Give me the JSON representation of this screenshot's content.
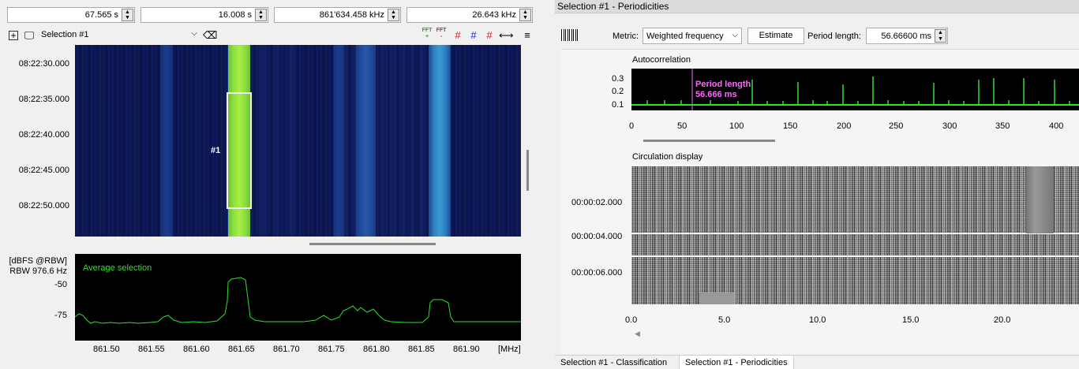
{
  "toolbar": {
    "start_time": "67.565 s",
    "duration": "16.008 s",
    "center_freq": "861'634.458 kHz",
    "bandwidth": "26.643 kHz",
    "selection_combo": "Selection #1"
  },
  "waterfall": {
    "time_labels": [
      "08:22:30.000",
      "08:22:35.000",
      "08:22:40.000",
      "08:22:45.000",
      "08:22:50.000"
    ],
    "selection_label": "#1"
  },
  "spectrum": {
    "y_unit": "[dBFS @RBW]",
    "rbw": "RBW 976.6 Hz",
    "trace_label": "Average selection",
    "y_labels": [
      "-50",
      "-75"
    ],
    "x_labels": [
      "861.50",
      "861.55",
      "861.60",
      "861.65",
      "861.70",
      "861.75",
      "861.80",
      "861.85",
      "861.90"
    ],
    "x_unit": "[MHz]"
  },
  "right": {
    "title": "Selection #1 - Periodicities",
    "metric_label": "Metric:",
    "metric_value": "Weighted frequency",
    "estimate_button": "Estimate",
    "period_label": "Period length:",
    "period_value": "56.66600 ms"
  },
  "autocorr": {
    "title": "Autocorrelation",
    "marker_text_1": "Period length",
    "marker_text_2": "56.666 ms",
    "y_labels": [
      "0.3",
      "0.2",
      "0.1"
    ],
    "x_labels": [
      "0",
      "50",
      "100",
      "150",
      "200",
      "250",
      "300",
      "350",
      "400"
    ]
  },
  "circulation": {
    "title": "Circulation display",
    "y_labels": [
      "00:00:02.000",
      "00:00:04.000",
      "00:00:06.000"
    ],
    "x_labels": [
      "0.0",
      "5.0",
      "10.0",
      "15.0",
      "20.0"
    ]
  },
  "tabs": [
    "Selection #1 - Classification",
    "Selection #1 - Periodicities"
  ],
  "colors": {
    "trace": "#33dd33",
    "marker": "#ff66ff",
    "waterfall_bg": "#0d1550"
  }
}
